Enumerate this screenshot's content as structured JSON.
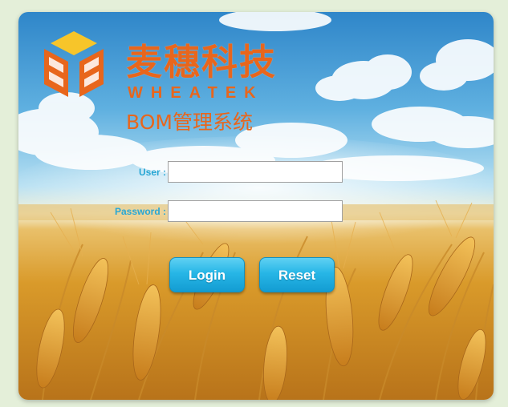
{
  "brand": {
    "name_cn": "麦穗科技",
    "name_en": "WHEATEK",
    "logo_icon": "wheat-hexagon-logo",
    "color": "#e8661c"
  },
  "system": {
    "title": "BOM管理系统"
  },
  "form": {
    "user_label": "User :",
    "user_value": "",
    "password_label": "Password :",
    "password_value": "",
    "login_label": "Login",
    "reset_label": "Reset",
    "label_color": "#29a7d4",
    "button_color": "#27b6e6"
  },
  "background": {
    "description_icon": "wheat-field-sky-background"
  }
}
